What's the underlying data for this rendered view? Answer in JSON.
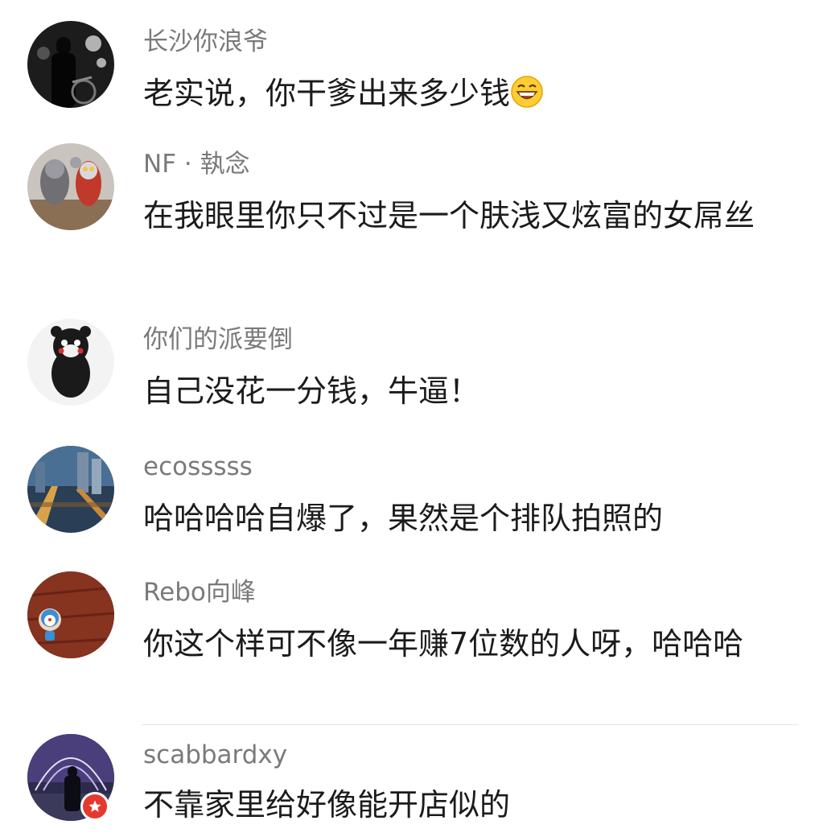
{
  "comments": [
    {
      "username": "长沙你浪爷",
      "text": "老实说，你干爹出来多少钱",
      "emoji": "laughing-emoji"
    },
    {
      "username": "NF · 執念",
      "text": "在我眼里你只不过是一个肤浅又炫富的女屌丝"
    },
    {
      "username": "你们的派要倒",
      "text": "自己没花一分钱，牛逼！"
    },
    {
      "username": "ecosssss",
      "text": "哈哈哈哈自爆了，果然是个排队拍照的"
    },
    {
      "username": "Rebo向峰",
      "text": "你这个样可不像一年赚7位数的人呀，哈哈哈"
    },
    {
      "username": "scabbardxy",
      "text": "不靠家里给好像能开店似的",
      "badge": "verified-star-icon"
    }
  ],
  "colors": {
    "username": "#7a7a7a",
    "text": "#1b1b1b",
    "badge": "#e5392f",
    "divider": "#e6e6e6"
  }
}
